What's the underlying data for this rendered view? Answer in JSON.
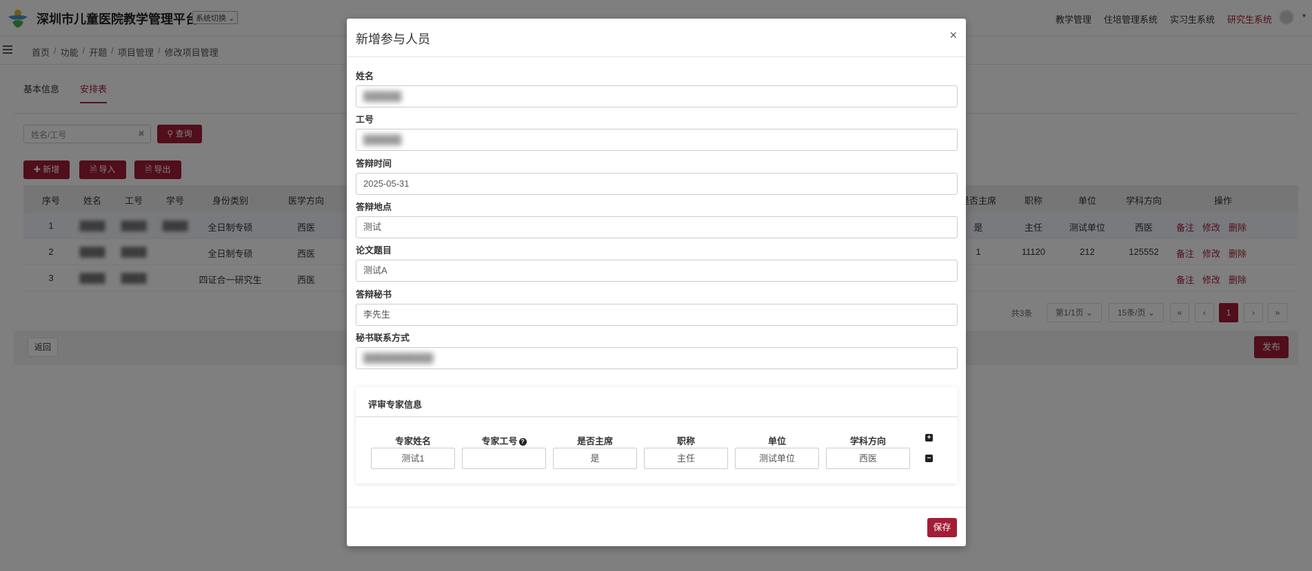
{
  "header": {
    "platform_title": "深圳市儿童医院教学管理平台",
    "system_switch": "系统切换",
    "nav": [
      "教学管理",
      "住培管理系统",
      "实习生系统",
      "研究生系统"
    ],
    "active_nav": "研究生系统"
  },
  "breadcrumb": [
    "首页",
    "功能",
    "开题",
    "项目管理",
    "修改项目管理"
  ],
  "tabs": [
    "基本信息",
    "安排表"
  ],
  "toolbar": {
    "search_placeholder": "姓名/工号",
    "query_label": "查询",
    "add_label": "新增",
    "import_label": "导入",
    "export_label": "导出"
  },
  "table": {
    "headers_left": [
      "序号",
      "姓名",
      "工号",
      "学号",
      "身份类别",
      "医学方向"
    ],
    "headers_right": [
      "是否主席",
      "职称",
      "单位",
      "学科方向",
      "操作"
    ],
    "rows": [
      {
        "no": "1",
        "name": "████",
        "id": "████",
        "sid": "████",
        "type": "全日制专硕",
        "dir": "西医",
        "chair": "是",
        "title": "主任",
        "unit": "测试单位",
        "subject": "西医"
      },
      {
        "no": "2",
        "name": "████",
        "id": "████",
        "sid": "",
        "type": "全日制专硕",
        "dir": "西医",
        "chair": "1",
        "title": "11120",
        "unit": "212",
        "subject": "125552"
      },
      {
        "no": "3",
        "name": "████",
        "id": "████",
        "sid": "",
        "type": "四证合一研究生",
        "dir": "西医",
        "chair": "",
        "title": "",
        "unit": "",
        "subject": ""
      }
    ],
    "ops": [
      "备注",
      "修改",
      "删除"
    ]
  },
  "pager": {
    "total": "共3条",
    "page_info": "第1/1页",
    "page_size": "15条/页",
    "first": "«",
    "prev": "‹",
    "current": "1",
    "next": "›",
    "last": "»"
  },
  "footer": {
    "back_label": "返回",
    "publish_label": "发布"
  },
  "modal": {
    "title": "新增参与人员",
    "close": "×",
    "fields": [
      {
        "label": "姓名",
        "value": "██████"
      },
      {
        "label": "工号",
        "value": "██████"
      },
      {
        "label": "答辩时间",
        "value": "2025-05-31"
      },
      {
        "label": "答辩地点",
        "value": "测试"
      },
      {
        "label": "论文题目",
        "value": "测试A"
      },
      {
        "label": "答辩秘书",
        "value": "李先生"
      },
      {
        "label": "秘书联系方式",
        "value": "███████████"
      }
    ],
    "expert_section_title": "评审专家信息",
    "expert_headers": [
      "专家姓名",
      "专家工号",
      "是否主席",
      "职称",
      "单位",
      "学科方向"
    ],
    "expert_help_icon": "?",
    "expert_row": [
      "测试1",
      "",
      "是",
      "主任",
      "测试单位",
      "西医"
    ],
    "add_row_icon": "+",
    "remove_row_icon": "−",
    "save_label": "保存"
  },
  "colors": {
    "accent": "#a31d36",
    "overlay": "rgba(0,0,0,0.5)"
  }
}
